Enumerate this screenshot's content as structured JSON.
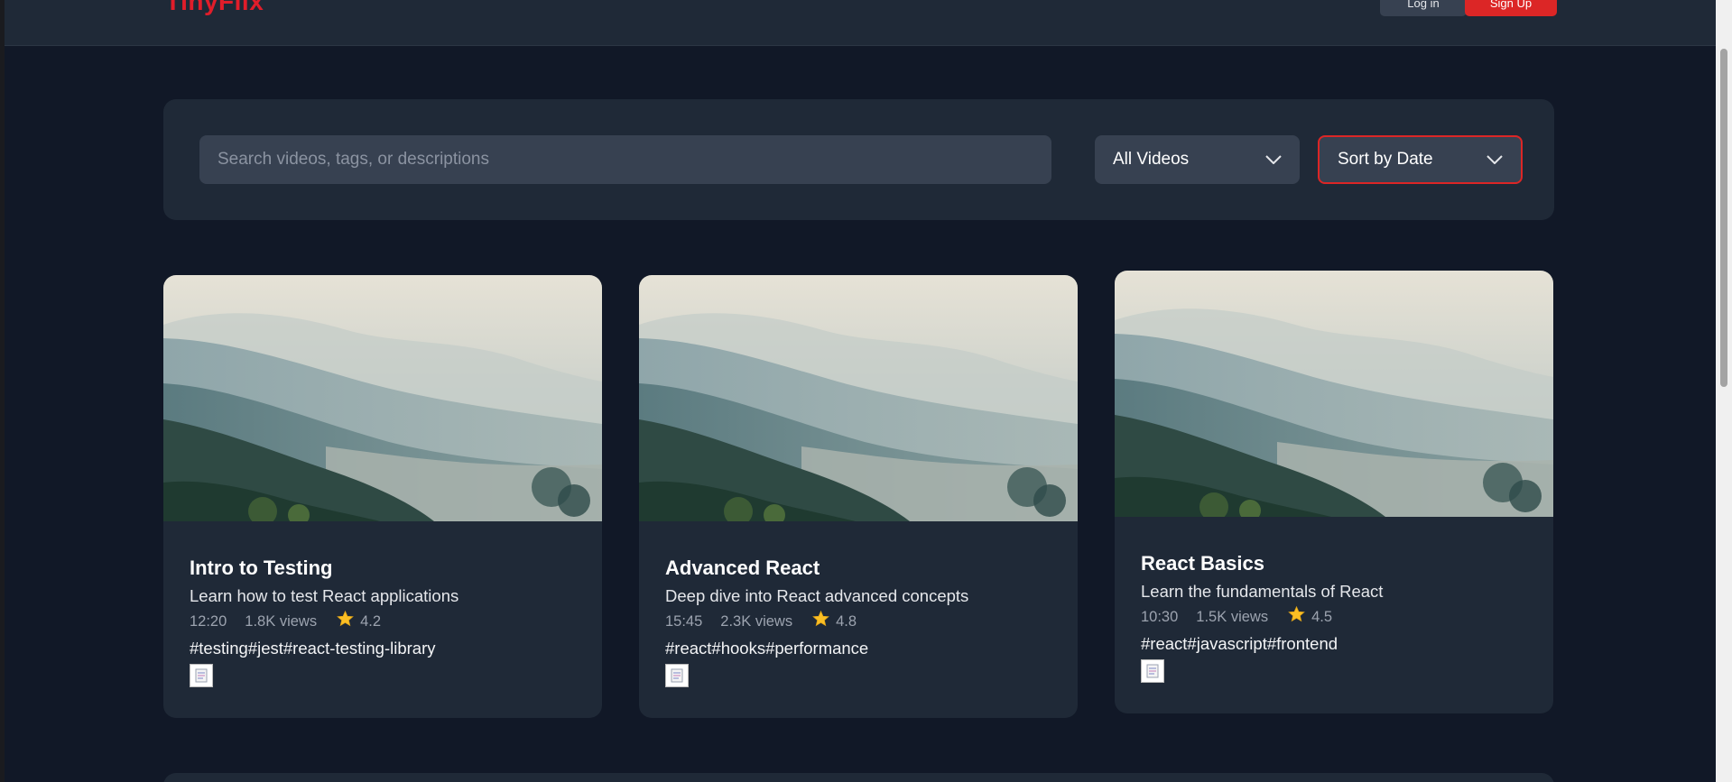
{
  "header": {
    "logo": "TinyFlix",
    "login_label": "Log in",
    "signup_label": "Sign Up"
  },
  "filters": {
    "search_placeholder": "Search videos, tags, or descriptions",
    "category_selected": "All Videos",
    "sort_selected": "Sort by Date"
  },
  "videos": [
    {
      "title": "Intro to Testing",
      "description": "Learn how to test React applications",
      "duration": "12:20",
      "views": "1.8K views",
      "rating": "4.2",
      "tags": "#testing#jest#react-testing-library"
    },
    {
      "title": "Advanced React",
      "description": "Deep dive into React advanced concepts",
      "duration": "15:45",
      "views": "2.3K views",
      "rating": "4.8",
      "tags": "#react#hooks#performance"
    },
    {
      "title": "React Basics",
      "description": "Learn the fundamentals of React",
      "duration": "10:30",
      "views": "1.5K views",
      "rating": "4.5",
      "tags": "#react#javascript#frontend"
    }
  ],
  "colors": {
    "accent": "#dc2626",
    "background": "#111827",
    "panel": "#1f2937",
    "star": "#fbbf24"
  },
  "icons": [
    "chevron-down-icon",
    "star-icon",
    "document-icon"
  ]
}
